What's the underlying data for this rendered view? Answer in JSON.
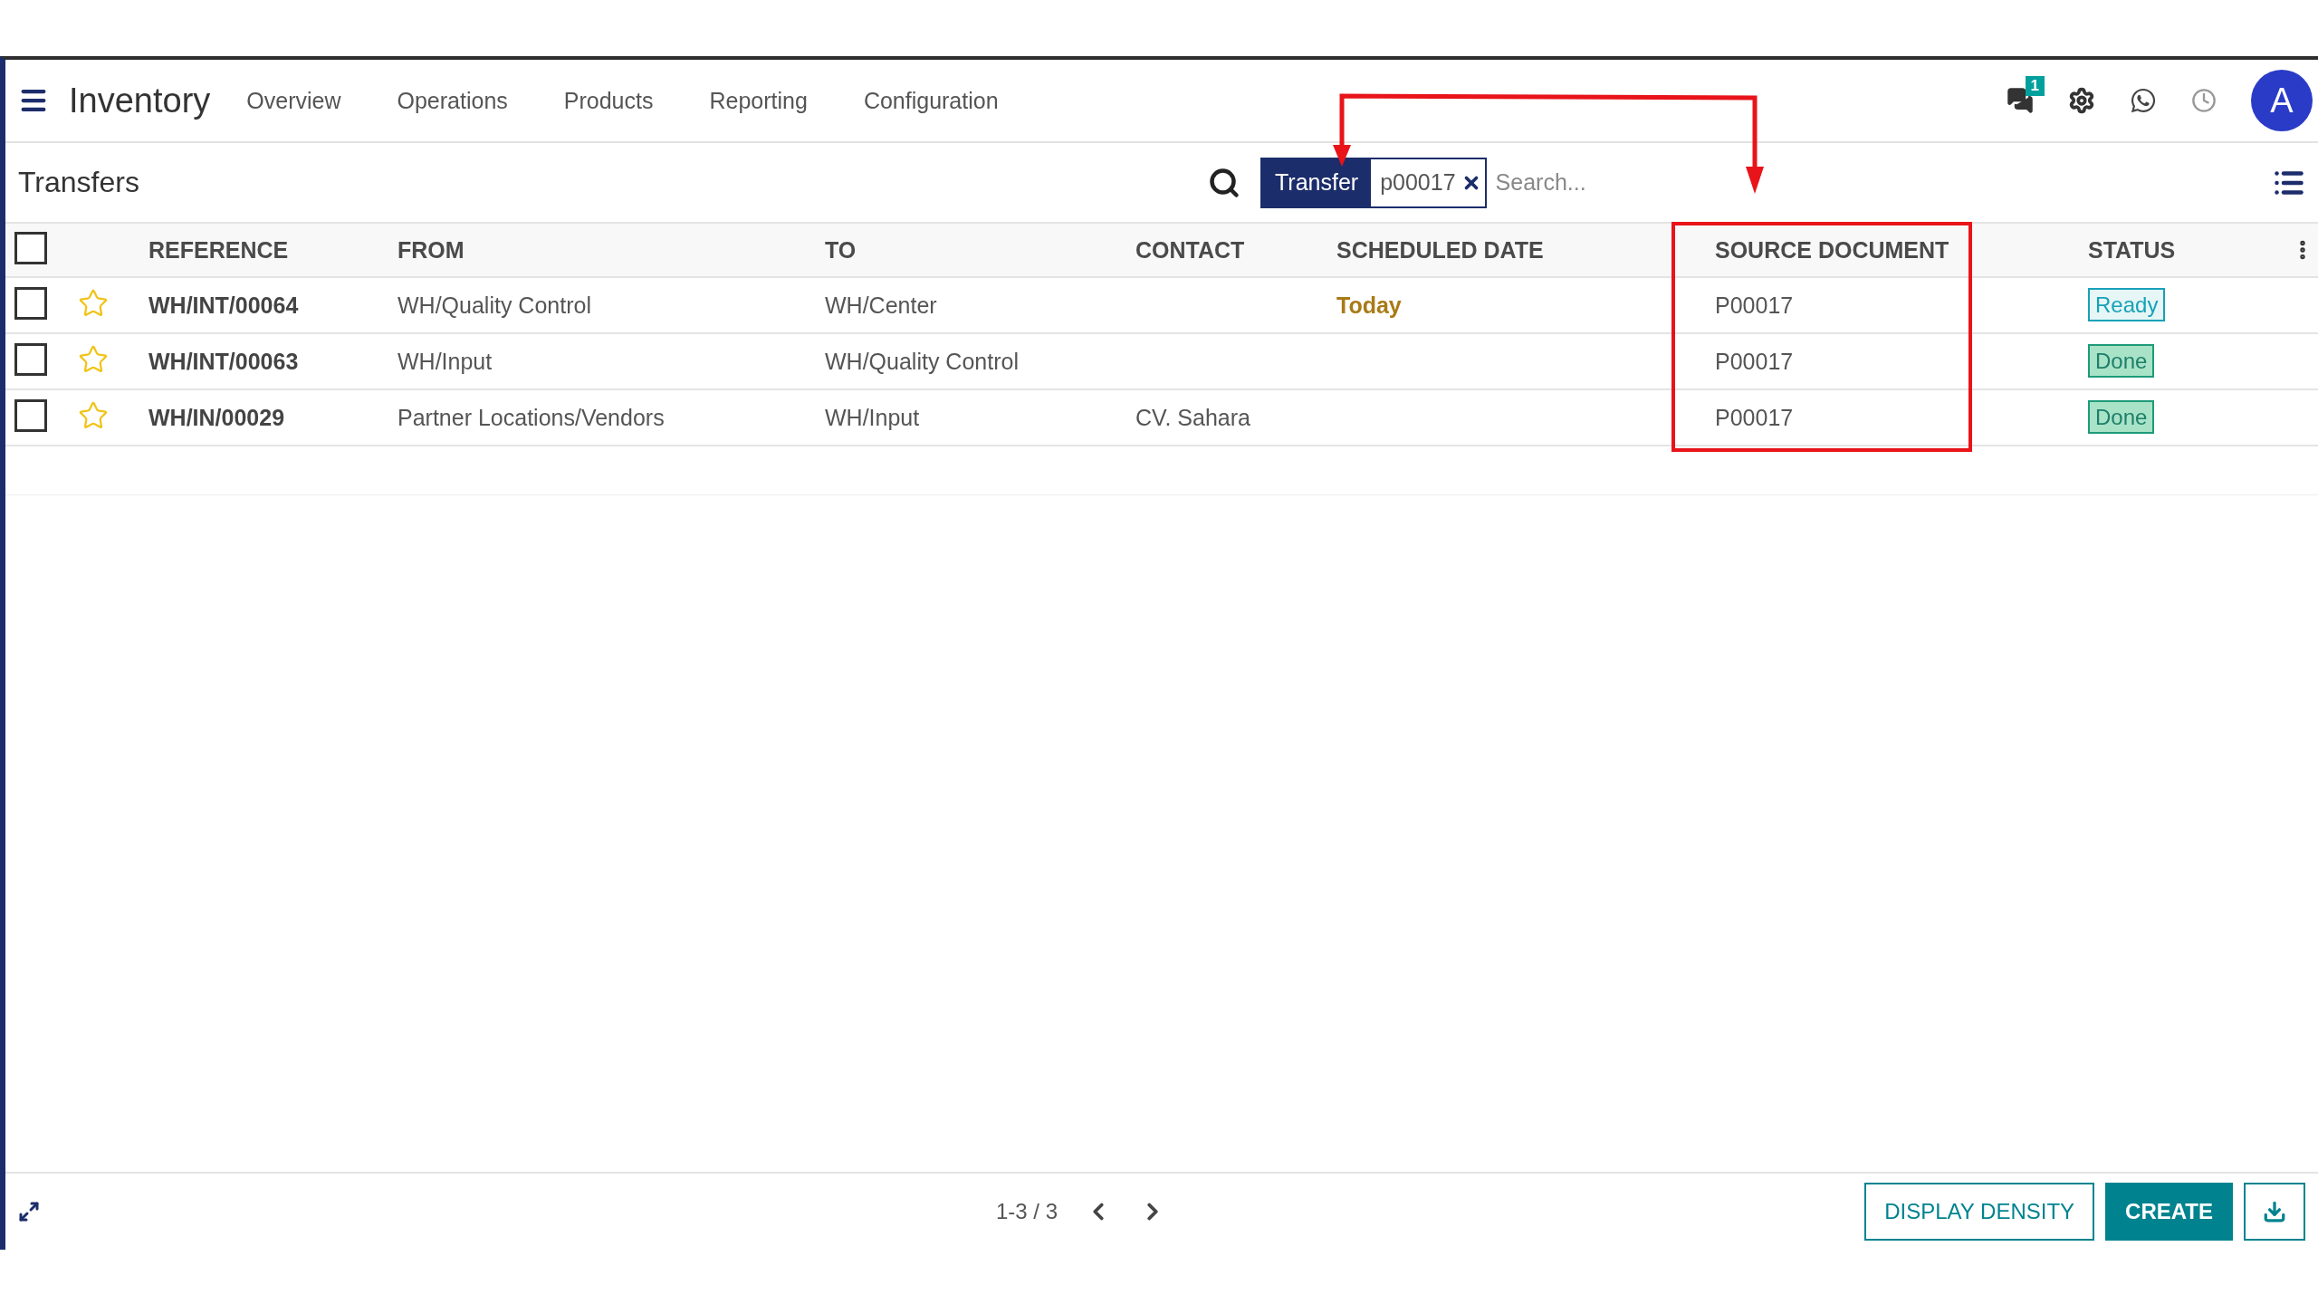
{
  "navbar": {
    "app_name": "Inventory",
    "menu": [
      "Overview",
      "Operations",
      "Products",
      "Reporting",
      "Configuration"
    ],
    "messages_badge": "1",
    "avatar": "A"
  },
  "control_panel": {
    "title": "Transfers",
    "facet": {
      "label": "Transfer",
      "value": "p00017"
    },
    "search": {
      "placeholder": "Search..."
    }
  },
  "table": {
    "header_checked": false,
    "columns": [
      "REFERENCE",
      "FROM",
      "TO",
      "CONTACT",
      "SCHEDULED DATE",
      "SOURCE DOCUMENT",
      "STATUS"
    ],
    "rows": [
      {
        "checked": false,
        "starred": false,
        "reference": "WH/INT/00064",
        "from": "WH/Quality Control",
        "to": "WH/Center",
        "contact": "",
        "scheduled_date": "Today",
        "source_document": "P00017",
        "status": {
          "label": "Ready",
          "kind": "ready"
        }
      },
      {
        "checked": false,
        "starred": false,
        "reference": "WH/INT/00063",
        "from": "WH/Input",
        "to": "WH/Quality Control",
        "contact": "",
        "scheduled_date": "",
        "source_document": "P00017",
        "status": {
          "label": "Done",
          "kind": "done"
        }
      },
      {
        "checked": false,
        "starred": false,
        "reference": "WH/IN/00029",
        "from": "Partner Locations/Vendors",
        "to": "WH/Input",
        "contact": "CV. Sahara",
        "scheduled_date": "",
        "source_document": "P00017",
        "status": {
          "label": "Done",
          "kind": "done"
        }
      }
    ]
  },
  "footer": {
    "pager": "1-3 / 3",
    "buttons": [
      "DISPLAY DENSITY",
      "CREATE"
    ]
  }
}
